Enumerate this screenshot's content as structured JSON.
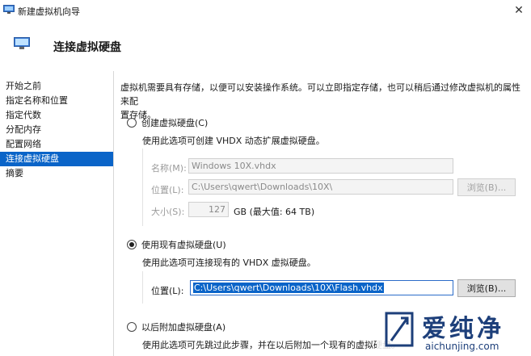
{
  "window": {
    "title": "新建虚拟机向导",
    "close_glyph": "✕"
  },
  "header": {
    "title": "连接虚拟硬盘"
  },
  "sidebar": {
    "items": [
      {
        "label": "开始之前",
        "active": false
      },
      {
        "label": "指定名称和位置",
        "active": false
      },
      {
        "label": "指定代数",
        "active": false
      },
      {
        "label": "分配内存",
        "active": false
      },
      {
        "label": "配置网络",
        "active": false
      },
      {
        "label": "连接虚拟硬盘",
        "active": true
      },
      {
        "label": "摘要",
        "active": false
      }
    ]
  },
  "main": {
    "intro_line1": "虚拟机需要具有存储，以便可以安装操作系统。可以立即指定存储，也可以稍后通过修改虚拟机的属性来配",
    "intro_line2": "置存储。",
    "option_create": {
      "label": "创建虚拟硬盘(C)",
      "selected": false,
      "desc": "使用此选项可创建 VHDX 动态扩展虚拟硬盘。",
      "name_label": "名称(M):",
      "name_value": "Windows 10X.vhdx",
      "location_label": "位置(L):",
      "location_value": "C:\\Users\\qwert\\Downloads\\10X\\",
      "browse_label": "浏览(B)...",
      "size_label": "大小(S):",
      "size_value": "127",
      "size_unit": "GB (最大值: 64 TB)"
    },
    "option_existing": {
      "label": "使用现有虚拟硬盘(U)",
      "selected": true,
      "desc": "使用此选项可连接现有的 VHDX 虚拟硬盘。",
      "location_label": "位置(L):",
      "location_value": "C:\\Users\\qwert\\Downloads\\10X\\Flash.vhdx",
      "browse_label": "浏览(B)..."
    },
    "option_later": {
      "label": "以后附加虚拟硬盘(A)",
      "selected": false,
      "desc": "使用此选项可先跳过此步骤，并在以后附加一个现有的虚拟硬盘。"
    }
  },
  "watermark": {
    "brand": "爱纯净",
    "url": "aichunjing.com"
  },
  "colors": {
    "accent": "#0a64c8",
    "watermark": "#1d3f7a"
  }
}
